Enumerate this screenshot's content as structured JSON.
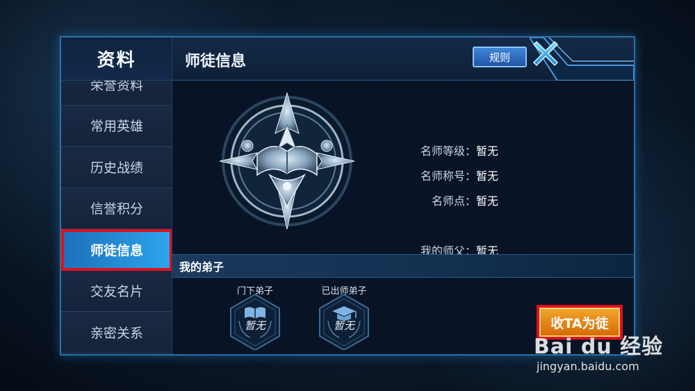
{
  "sidebar": {
    "title": "资料",
    "items": [
      {
        "label": "荣誉资料"
      },
      {
        "label": "常用英雄"
      },
      {
        "label": "历史战绩"
      },
      {
        "label": "信誉积分"
      },
      {
        "label": "师徒信息"
      },
      {
        "label": "交友名片"
      },
      {
        "label": "亲密关系"
      }
    ],
    "active_index": 4
  },
  "header": {
    "title": "师徒信息",
    "rules_label": "规则",
    "close_icon": "close-x-icon"
  },
  "info": {
    "rows": [
      {
        "label": "名师等级：",
        "value": "暂无"
      },
      {
        "label": "名师称号：",
        "value": "暂无"
      },
      {
        "label": "名师点：",
        "value": "暂无"
      },
      {
        "label": "我的师父：",
        "value": "暂无"
      }
    ]
  },
  "disciples": {
    "section_title": "我的弟子",
    "badges": [
      {
        "label": "门下弟子",
        "value": "暂无",
        "icon": "open-book-icon"
      },
      {
        "label": "已出师弟子",
        "value": "暂无",
        "icon": "graduation-cap-icon"
      }
    ]
  },
  "recruit_button": "收TA为徒",
  "watermark": {
    "brand": "Bai du 经验",
    "url": "jingyan.baidu.com"
  },
  "colors": {
    "active_tab": "#2ea6ef",
    "highlight_border": "#e0101b",
    "recruit_button": "#e58a14",
    "panel_border": "#2f6fa6"
  }
}
